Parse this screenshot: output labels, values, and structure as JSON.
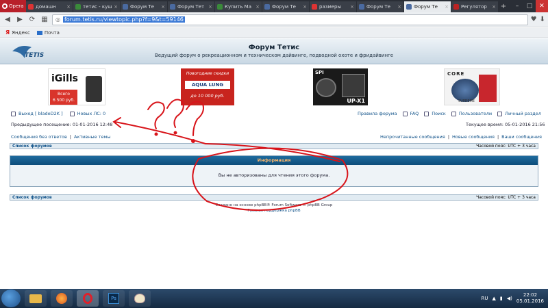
{
  "browser": {
    "opera_label": "Opera",
    "tabs": [
      {
        "title": "домашн",
        "fav_color": "#d33",
        "active": false
      },
      {
        "title": "тетис - кущ",
        "fav_color": "#3a8a3a",
        "active": false
      },
      {
        "title": "Форум Те",
        "fav_color": "#4a6aa0",
        "active": false
      },
      {
        "title": "Форум Тет",
        "fav_color": "#4a6aa0",
        "active": false
      },
      {
        "title": "Купить Ма",
        "fav_color": "#3a8a3a",
        "active": false
      },
      {
        "title": "Форум Те",
        "fav_color": "#4a6aa0",
        "active": false
      },
      {
        "title": "размеры",
        "fav_color": "#d33",
        "active": false
      },
      {
        "title": "Форум Те",
        "fav_color": "#4a6aa0",
        "active": false
      },
      {
        "title": "Форум Те",
        "fav_color": "#4a6aa0",
        "active": true
      },
      {
        "title": "Регулятор",
        "fav_color": "#b22",
        "active": false
      }
    ],
    "url": "forum.tetis.ru/viewtopic.php?f=9&t=59146",
    "bookmarks": [
      {
        "label": "Яндекс"
      },
      {
        "label": "Почта"
      }
    ]
  },
  "forum": {
    "title": "Форум Тетис",
    "description": "Ведущий форум о рекреационном и техническом дайвинге, подводной охоте и фридайвинге",
    "logo_text": "TETIS",
    "banners": {
      "b1_brand": "iGills",
      "b1_price_line1": "Всего",
      "b1_price_line2": "6 500 руб.",
      "b2_line1": "Новогодние скидки",
      "b2_brand": "AQUA LUNG",
      "b2_line2": "до 10 000 руб.",
      "b3_brand": "UP-X1",
      "b3_top": "SPI",
      "b4_brand": "CORE",
      "b4_sub": "SUPREME"
    },
    "user": {
      "logout_label": "Выход [ bladeD2K ]",
      "new_pm_label": "Новых ЛС: 0",
      "last_visit": "Предыдущее посещение: 01-01-2016 12:48",
      "current_time": "Текущее время: 05-01-2016 21:56"
    },
    "menu": {
      "rules": "Правила форума",
      "faq": "FAQ",
      "search": "Поиск",
      "users": "Пользователи",
      "private": "Личный раздел"
    },
    "links_left": {
      "unanswered": "Сообщения без ответов",
      "sep": "|",
      "active": "Активные темы"
    },
    "links_right": {
      "unread": "Непрочитанные сообщения",
      "new_posts": "Новые сообщения",
      "your_posts": "Ваши сообщения",
      "sep": "|"
    },
    "nav_strip": {
      "forum_list": "Список форумов",
      "timezone": "Часовой пояс: UTC + 3 часа"
    },
    "info": {
      "heading": "Информация",
      "message": "Вы не авторизованы для чтения этого форума."
    },
    "footer": {
      "line1": "Создано на основе phpBB® Forum Software © phpBB Group",
      "line2": "Русская поддержка phpBB"
    },
    "annotation_color": "#d8141a"
  },
  "taskbar": {
    "lang": "RU",
    "time": "22:02",
    "date": "05.01.2016",
    "apps": [
      "explorer-icon",
      "firefox-icon",
      "opera-icon",
      "photoshop-icon",
      "paint-icon"
    ]
  }
}
